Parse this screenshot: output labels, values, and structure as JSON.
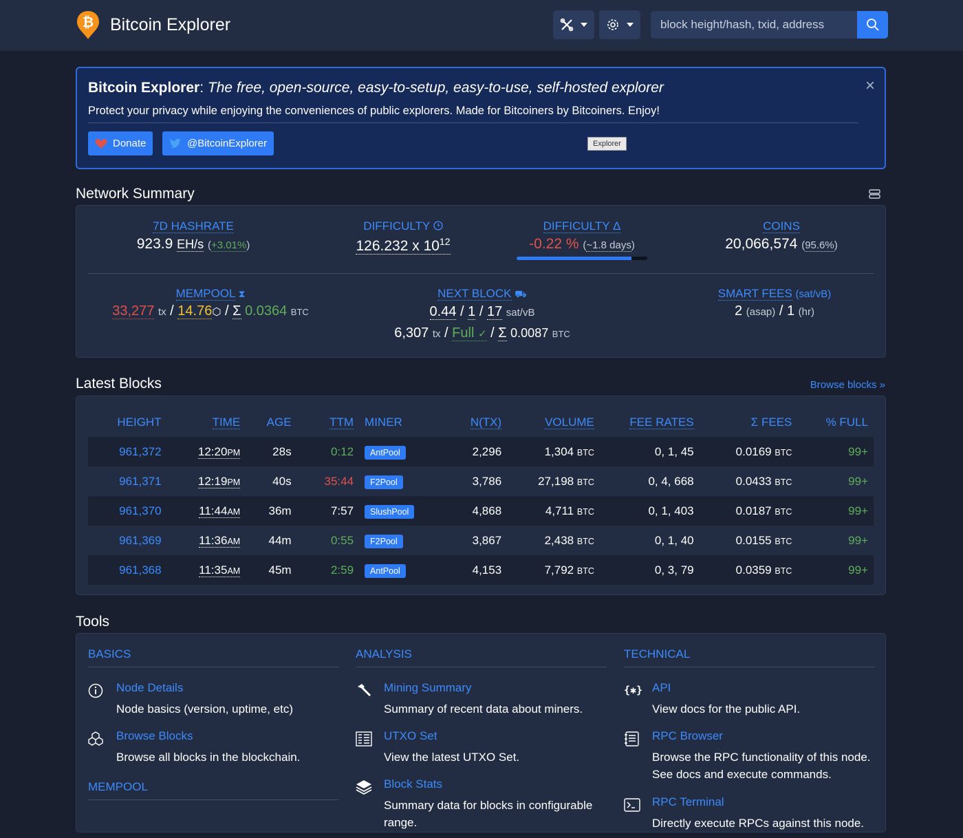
{
  "header": {
    "brand": "Bitcoin Explorer",
    "search_placeholder": "block height/hash, txid, address"
  },
  "banner": {
    "title_bold": "Bitcoin Explorer",
    "title_rest": ": ",
    "title_italic": "The free, open-source, easy-to-setup, easy-to-use, self-hosted explorer",
    "subtitle": "Protect your privacy while enjoying the conveniences of public explorers. Made for Bitcoiners by Bitcoiners. Enjoy!",
    "donate_label": "Donate",
    "twitter_label": "@BitcoinExplorer",
    "tag": "Explorer"
  },
  "network": {
    "title": "Network Summary",
    "hashrate_label": "7D HASHRATE",
    "hashrate_value": "923.9",
    "hashrate_unit": "EH/s",
    "hashrate_change": "+3.01%",
    "difficulty_label": "DIFFICULTY",
    "difficulty_value": "126.232 x 10",
    "difficulty_exp": "12",
    "diffdelta_label": "DIFFICULTY Δ",
    "diffdelta_value": "-0.22 %",
    "diffdelta_eta": "~1.8 days",
    "diffdelta_progress": 0.88,
    "coins_label": "COINS",
    "coins_value": "20,066,574",
    "coins_pct": "95.6%",
    "mempool_label": "MEMPOOL",
    "mempool_tx": "33,277",
    "mempool_tx_unit": "tx",
    "mempool_size": "14.76",
    "mempool_fees": "0.0364",
    "mempool_fees_unit": "BTC",
    "nextblock_label": "NEXT BLOCK",
    "nextblock_rate_min": "0.44",
    "nextblock_rate_med": "1",
    "nextblock_rate_max": "17",
    "nextblock_rate_unit": "sat/vB",
    "nextblock_tx": "6,307",
    "nextblock_tx_unit": "tx",
    "nextblock_full": "Full",
    "nextblock_fees": "0.0087",
    "nextblock_fees_unit": "BTC",
    "smartfees_label": "SMART FEES",
    "smartfees_unit": "(sat/vB)",
    "smartfees_asap": "2",
    "smartfees_asap_lbl": "(asap)",
    "smartfees_hr": "1",
    "smartfees_hr_lbl": "(hr)"
  },
  "latest_blocks": {
    "title": "Latest Blocks",
    "browse_link": "Browse blocks »",
    "columns": [
      "HEIGHT",
      "TIME",
      "AGE",
      "TTM",
      "MINER",
      "N(TX)",
      "VOLUME",
      "FEE RATES",
      "Σ FEES",
      "% FULL"
    ],
    "rows": [
      {
        "height": "961,372",
        "time": "12:20",
        "ampm": "PM",
        "age": "28s",
        "ttm": "0:12",
        "ttm_color": "green",
        "miner": "AntPool",
        "ntx": "2,296",
        "volume": "1,304",
        "fee_rates": "0, 1, 45",
        "fees": "0.0169",
        "full": "99+"
      },
      {
        "height": "961,371",
        "time": "12:19",
        "ampm": "PM",
        "age": "40s",
        "ttm": "35:44",
        "ttm_color": "red",
        "miner": "F2Pool",
        "ntx": "3,786",
        "volume": "27,198",
        "fee_rates": "0, 4, 668",
        "fees": "0.0433",
        "full": "99+"
      },
      {
        "height": "961,370",
        "time": "11:44",
        "ampm": "AM",
        "age": "36m",
        "ttm": "7:57",
        "ttm_color": "white",
        "miner": "SlushPool",
        "ntx": "4,868",
        "volume": "4,711",
        "fee_rates": "0, 1, 403",
        "fees": "0.0187",
        "full": "99+"
      },
      {
        "height": "961,369",
        "time": "11:36",
        "ampm": "AM",
        "age": "44m",
        "ttm": "0:55",
        "ttm_color": "green",
        "miner": "F2Pool",
        "ntx": "3,867",
        "volume": "2,438",
        "fee_rates": "0, 1, 40",
        "fees": "0.0155",
        "full": "99+"
      },
      {
        "height": "961,368",
        "time": "11:35",
        "ampm": "AM",
        "age": "45m",
        "ttm": "2:59",
        "ttm_color": "green",
        "miner": "AntPool",
        "ntx": "4,153",
        "volume": "7,792",
        "fee_rates": "0, 3, 79",
        "fees": "0.0359",
        "full": "99+"
      }
    ],
    "btc_unit": "BTC"
  },
  "tools": {
    "title": "Tools",
    "basics": {
      "heading": "BASICS",
      "items": [
        {
          "title": "Node Details",
          "desc": "Node basics (version, uptime, etc)"
        },
        {
          "title": "Browse Blocks",
          "desc": "Browse all blocks in the blockchain."
        }
      ]
    },
    "mempool_heading": "MEMPOOL",
    "analysis": {
      "heading": "ANALYSIS",
      "items": [
        {
          "title": "Mining Summary",
          "desc": "Summary of recent data about miners."
        },
        {
          "title": "UTXO Set",
          "desc": "View the latest UTXO Set."
        },
        {
          "title": "Block Stats",
          "desc": "Summary data for blocks in configurable range."
        }
      ]
    },
    "technical": {
      "heading": "TECHNICAL",
      "items": [
        {
          "title": "API",
          "desc": "View docs for the public API."
        },
        {
          "title": "RPC Browser",
          "desc": "Browse the RPC functionality of this node. See docs and execute commands."
        },
        {
          "title": "RPC Terminal",
          "desc": "Directly execute RPCs against this node."
        }
      ]
    }
  }
}
